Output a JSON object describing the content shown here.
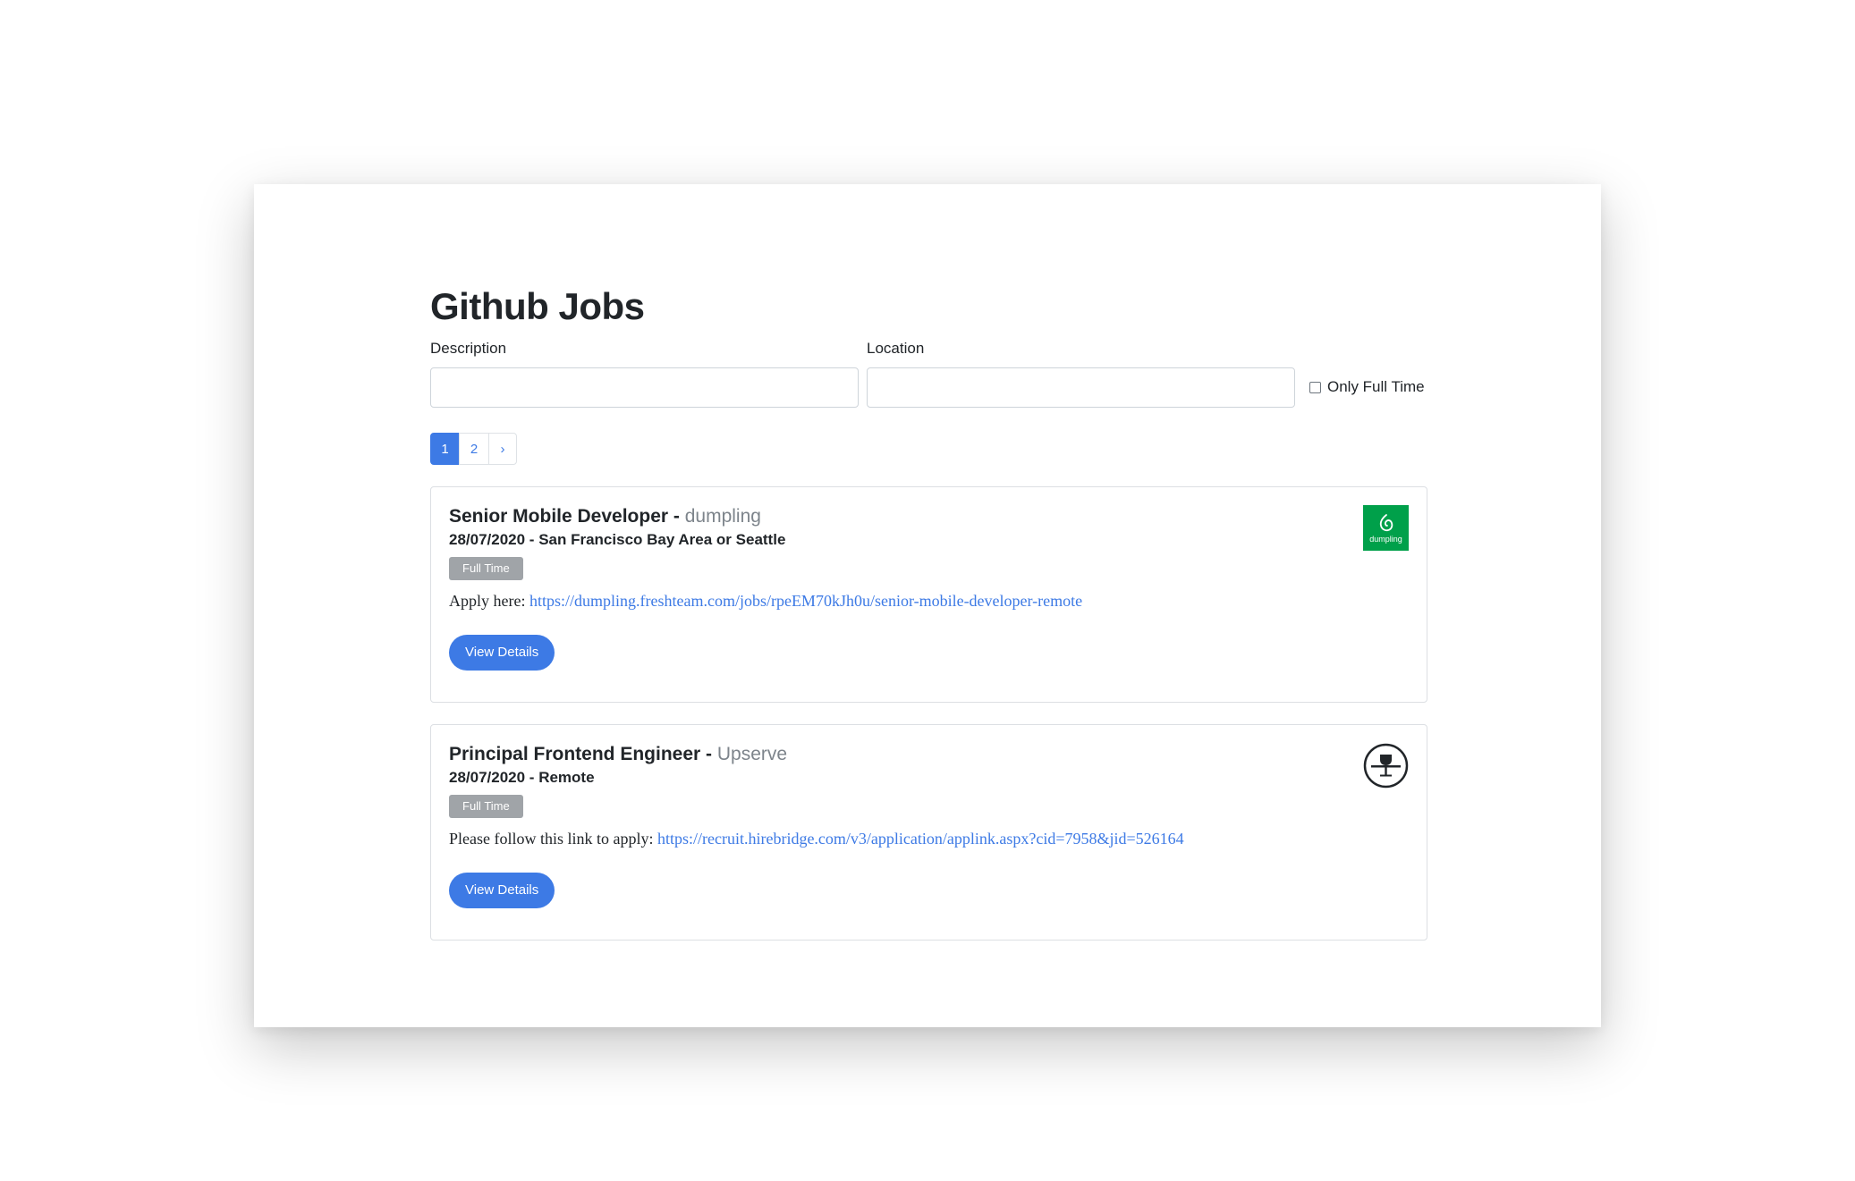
{
  "page": {
    "title": "Github Jobs"
  },
  "search": {
    "description_label": "Description",
    "description_value": "",
    "location_label": "Location",
    "location_value": "",
    "full_time_label": "Only Full Time",
    "full_time_checked": false
  },
  "pagination": {
    "pages": [
      "1",
      "2"
    ],
    "active_page": "1",
    "next_label": "›"
  },
  "jobs": [
    {
      "title": "Senior Mobile Developer - ",
      "company": "dumpling",
      "date_location": "28/07/2020 - San Francisco Bay Area or Seattle",
      "type_badge": "Full Time",
      "apply_text": "Apply here: ",
      "apply_url": "https://dumpling.freshteam.com/jobs/rpeEM70kJh0u/senior-mobile-developer-remote",
      "button_label": "View Details",
      "logo_icon": "dumpling-logo-icon",
      "logo_text": "dumpling",
      "logo_color": "#00a04a"
    },
    {
      "title": "Principal Frontend Engineer - ",
      "company": "Upserve",
      "date_location": "28/07/2020 - Remote",
      "type_badge": "Full Time",
      "apply_text": "Please follow this link to apply: ",
      "apply_url": "https://recruit.hirebridge.com/v3/application/applink.aspx?cid=7958&jid=526164",
      "button_label": "View Details",
      "logo_icon": "upserve-logo-icon"
    }
  ],
  "colors": {
    "accent": "#3d7ae5",
    "badge": "#a0a4a8",
    "muted_text": "#7d848b"
  }
}
